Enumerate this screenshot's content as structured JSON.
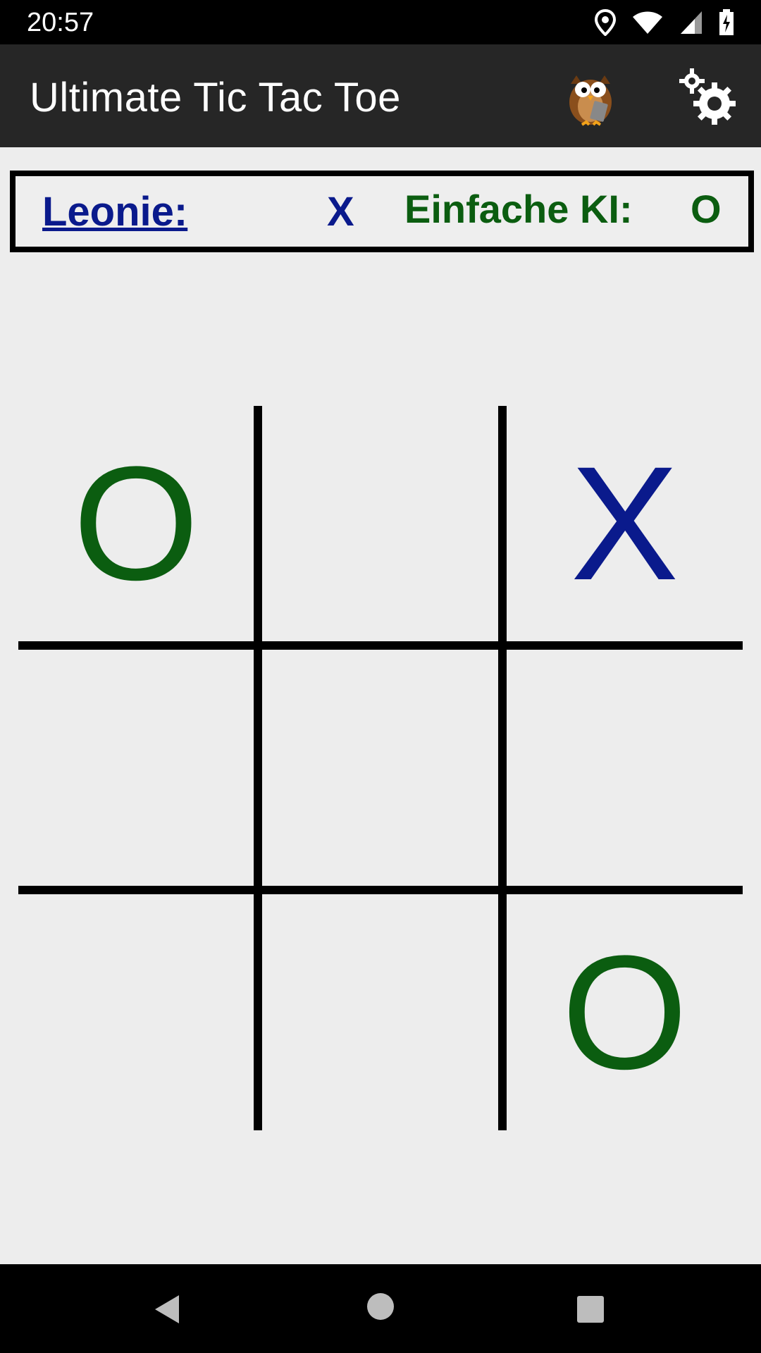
{
  "status_bar": {
    "time": "20:57",
    "icons": [
      "location-icon",
      "wifi-icon",
      "signal-icon",
      "battery-charging-icon"
    ]
  },
  "app_bar": {
    "title": "Ultimate Tic Tac Toe",
    "actions": [
      "owl-icon",
      "settings-gear-icon"
    ]
  },
  "scoreboard": {
    "player1_name": "Leonie:",
    "player1_symbol": "X",
    "player2_name": "Einfache KI:",
    "player2_symbol": "O",
    "colors": {
      "player1": "#0a1a8c",
      "player2": "#0b5d10"
    }
  },
  "board": {
    "cells": [
      "O",
      "",
      "X",
      "",
      "",
      "",
      "",
      "",
      "O"
    ]
  },
  "nav_bar": {
    "buttons": [
      "back-icon",
      "home-icon",
      "recents-icon"
    ]
  }
}
